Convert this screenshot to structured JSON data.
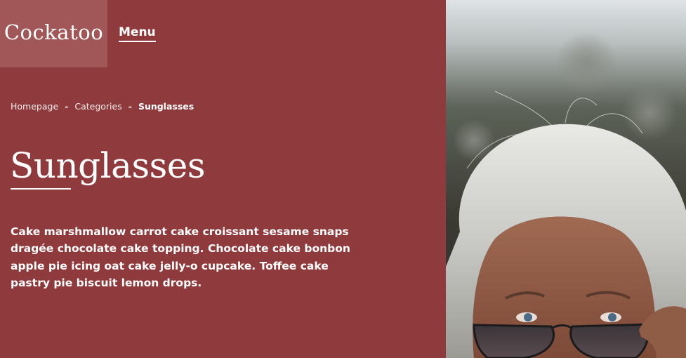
{
  "brand": {
    "logo_text": "Cockatoo"
  },
  "nav": {
    "menu_label": "Menu"
  },
  "breadcrumb": {
    "items": [
      "Homepage",
      "Categories",
      "Sunglasses"
    ],
    "separator": "-"
  },
  "page": {
    "title": "Sunglasses",
    "description": "Cake marshmallow carrot cake croissant sesame snaps dragée chocolate cake topping. Chocolate cake bonbon apple pie icing oat cake jelly-o cupcake. Toffee cake pastry pie biscuit lemon drops."
  },
  "colors": {
    "panel_background": "#8f3a3c",
    "logo_background": "#a15658",
    "text": "#ffffff"
  },
  "hero_image": {
    "subject": "woman-with-blonde-hair-and-sunglasses"
  }
}
